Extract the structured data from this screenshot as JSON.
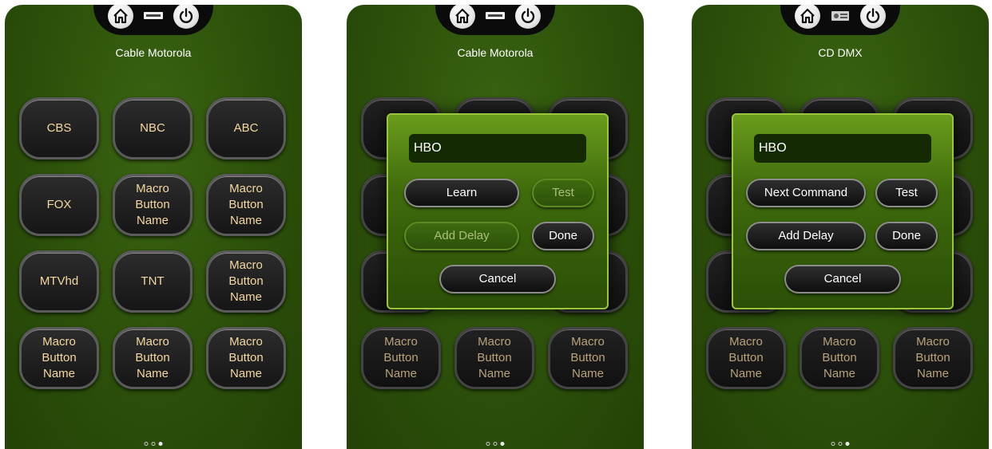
{
  "screens": [
    {
      "device_label": "Cable Motorola",
      "buttons": [
        "CBS",
        "NBC",
        "ABC",
        "FOX",
        "Macro\nButton\nName",
        "Macro\nButton\nName",
        "MTVhd",
        "TNT",
        "Macro\nButton\nName",
        "Macro\nButton\nName",
        "Macro\nButton\nName",
        "Macro\nButton\nName"
      ]
    },
    {
      "device_label": "Cable Motorola",
      "background_buttons": [
        "Macro\nButton\nName",
        "Macro\nButton\nName",
        "Macro\nButton\nName"
      ],
      "dialog": {
        "name_value": "HBO",
        "learn_label": "Learn",
        "test_label": "Test",
        "add_delay_label": "Add Delay",
        "done_label": "Done",
        "cancel_label": "Cancel",
        "disabled": [
          "test",
          "add_delay"
        ]
      }
    },
    {
      "device_label": "CD DMX",
      "background_buttons": [
        "Macro\nButton\nName",
        "Macro\nButton\nName",
        "Macro\nButton\nName"
      ],
      "dialog": {
        "name_value": "HBO",
        "next_command_label": "Next Command",
        "test_label": "Test",
        "add_delay_label": "Add Delay",
        "done_label": "Done",
        "cancel_label": "Cancel"
      }
    }
  ],
  "page_indicator": {
    "count": 3,
    "active_index": 2
  },
  "topbar_icons": [
    "home-icon",
    "device-icon",
    "power-icon"
  ],
  "colors": {
    "background": "#2c500a",
    "button_text": "#f5d8a0",
    "dialog_border": "#9bc53c"
  }
}
